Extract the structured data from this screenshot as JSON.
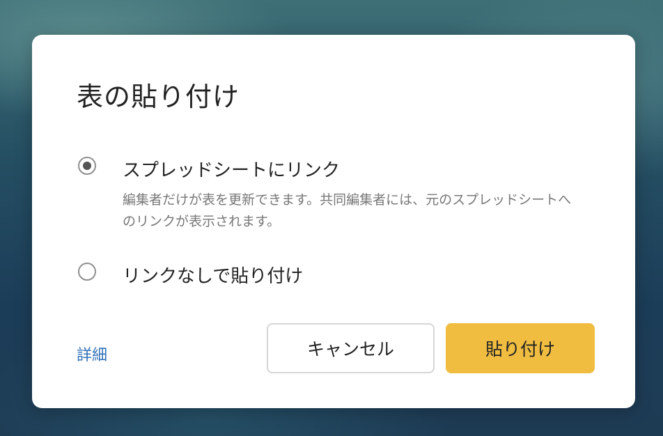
{
  "dialog": {
    "title": "表の貼り付け",
    "options": [
      {
        "label": "スプレッドシートにリンク",
        "description": "編集者だけが表を更新できます。共同編集者には、元のスプレッドシートへのリンクが表示されます。",
        "selected": true
      },
      {
        "label": "リンクなしで貼り付け",
        "selected": false
      }
    ],
    "details_link": "詳細",
    "cancel_label": "キャンセル",
    "paste_label": "貼り付け"
  },
  "colors": {
    "accent": "#f0bd41",
    "link": "#2f6fb7",
    "dialog_bg": "#ffffff"
  }
}
